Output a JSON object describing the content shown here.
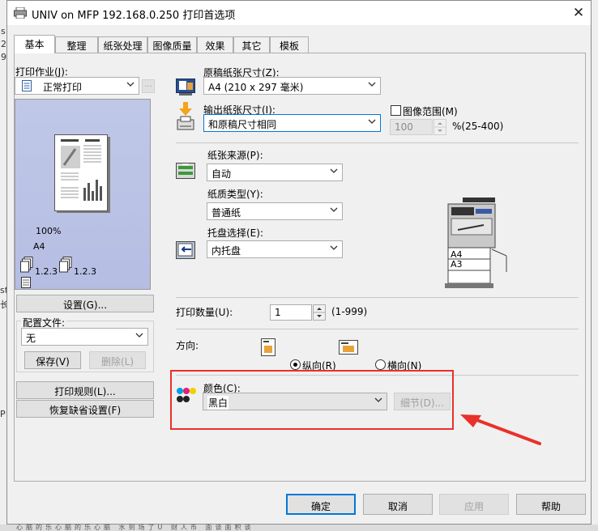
{
  "window": {
    "title": "UNIV on MFP 192.168.0.250 打印首选项",
    "close_label": "✕"
  },
  "tabs": [
    "基本",
    "整理",
    "纸张处理",
    "图像质量",
    "效果",
    "其它",
    "模板"
  ],
  "left": {
    "print_job_label": "打印作业(J):",
    "print_job_value": "正常打印",
    "more_label": "...",
    "preview_zoom": "100%",
    "preview_paper": "A4",
    "preview_collate_a": "1.2.3",
    "preview_collate_b": "1.2.3",
    "settings_button": "设置(G)...",
    "profile_label": "配置文件:",
    "profile_value": "无",
    "save_button": "保存(V)",
    "delete_button": "删除(L)",
    "print_rules_button": "打印规则(L)...",
    "restore_defaults_button": "恢复缺省设置(F)"
  },
  "paper": {
    "original_size_label": "原稿纸张尺寸(Z):",
    "original_size_value": "A4 (210 x 297 毫米)",
    "output_size_label": "输出纸张尺寸(I):",
    "output_size_value": "和原稿尺寸相同",
    "image_range_label": "图像范围(M)",
    "zoom_value": "100",
    "zoom_range": "%(25-400)",
    "source_label": "纸张来源(P):",
    "source_value": "自动",
    "type_label": "纸质类型(Y):",
    "type_value": "普通纸",
    "tray_label": "托盘选择(E):",
    "tray_value": "内托盘",
    "printer_tray_a4": "A4",
    "printer_tray_a3": "A3"
  },
  "copies": {
    "label": "打印数量(U):",
    "value": "1",
    "range": "(1-999)"
  },
  "orientation": {
    "label": "方向:",
    "portrait_label": "纵向(R)",
    "landscape_label": "横向(N)"
  },
  "color": {
    "label": "颜色(C):",
    "value": "黑白",
    "detail_button": "细节(D)..."
  },
  "footer": {
    "ok": "确定",
    "cancel": "取消",
    "apply": "应用",
    "help": "帮助"
  },
  "background": {
    "fragments": [
      "s",
      "2",
      "9",
      "st",
      "长",
      "P"
    ],
    "taskbar_text": "心脑的乐心脑的乐心脑 水到场了U 财人币 面谈面积谈"
  },
  "colors": {
    "accent": "#0078d7",
    "annotation": "#e8312a"
  }
}
